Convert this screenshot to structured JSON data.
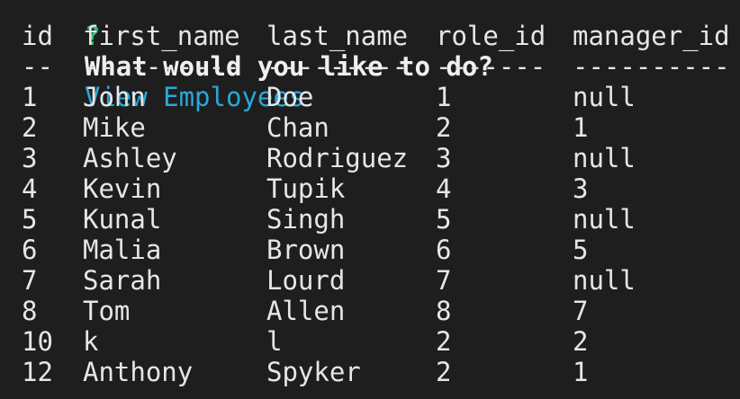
{
  "prompt": {
    "mark": "?",
    "question": "What would you like to do?",
    "answer": "View Employees"
  },
  "table": {
    "columns": [
      "id",
      "first_name",
      "last_name",
      "role_id",
      "manager_id"
    ],
    "separators": [
      "--",
      "----------",
      "---------",
      "-------",
      "----------"
    ],
    "rows": [
      [
        "1",
        "John",
        "Doe",
        "1",
        "null"
      ],
      [
        "2",
        "Mike",
        "Chan",
        "2",
        "1"
      ],
      [
        "3",
        "Ashley",
        "Rodriguez",
        "3",
        "null"
      ],
      [
        "4",
        "Kevin",
        "Tupik",
        "4",
        "3"
      ],
      [
        "5",
        "Kunal",
        "Singh",
        "5",
        "null"
      ],
      [
        "6",
        "Malia",
        "Brown",
        "6",
        "5"
      ],
      [
        "7",
        "Sarah",
        "Lourd",
        "7",
        "null"
      ],
      [
        "8",
        "Tom",
        "Allen",
        "8",
        "7"
      ],
      [
        "10",
        "k",
        "l",
        "2",
        "2"
      ],
      [
        "12",
        "Anthony",
        "Spyker",
        "2",
        "1"
      ]
    ]
  }
}
